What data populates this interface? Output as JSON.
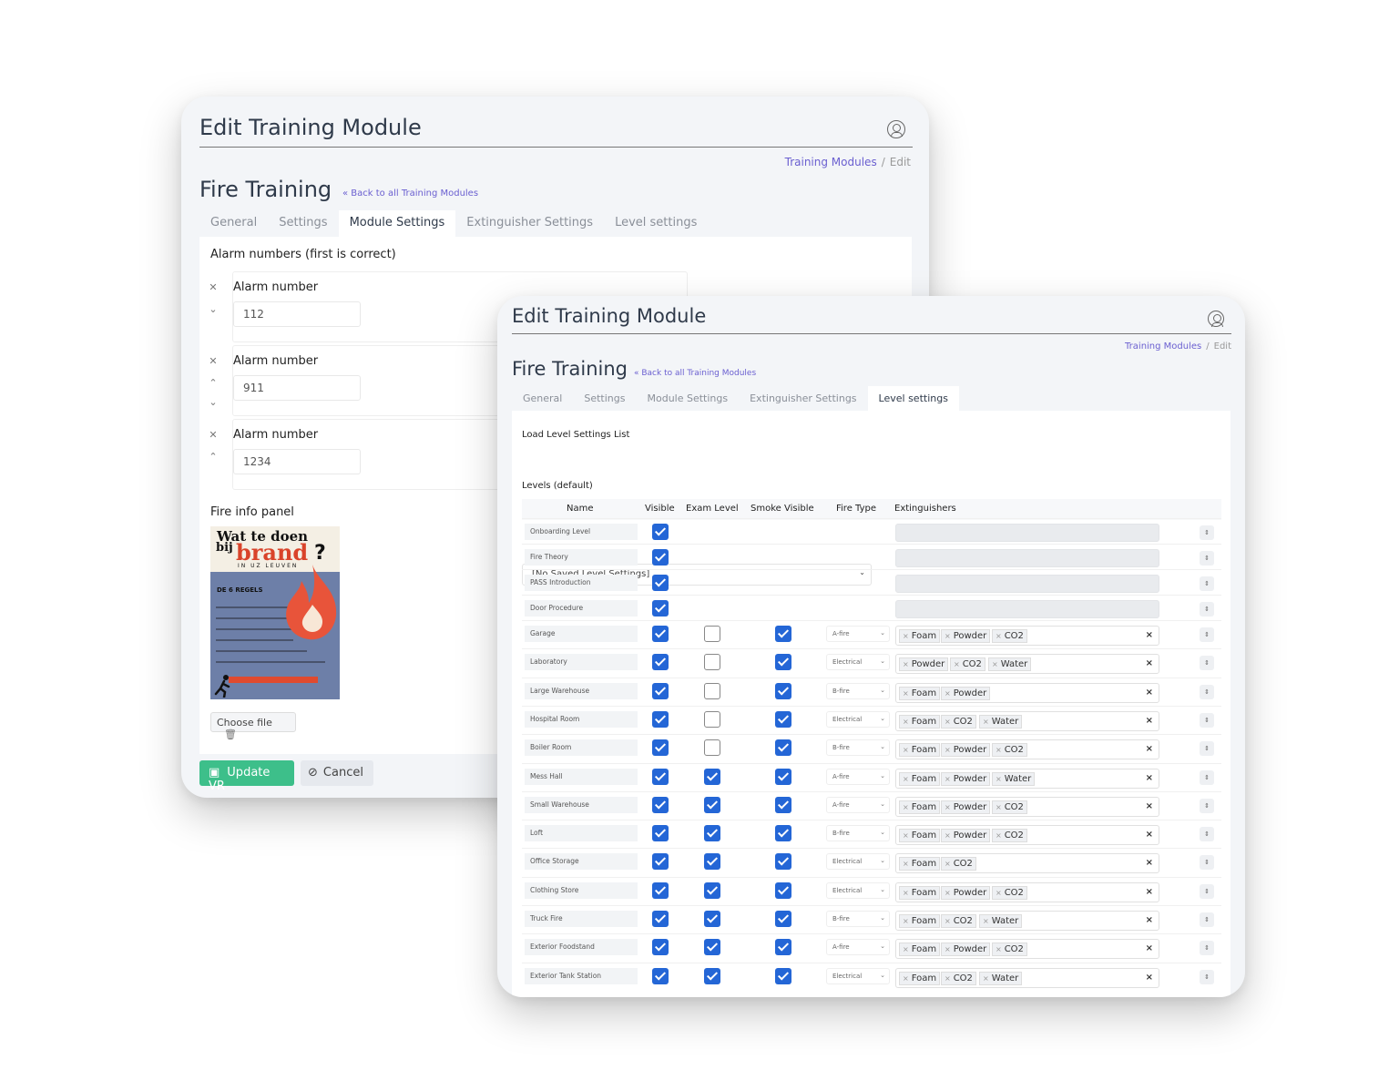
{
  "back_window": {
    "header_title": "Edit Training Module",
    "breadcrumb": {
      "link": "Training Modules",
      "separator": "/",
      "current": "Edit"
    },
    "page_title": "Fire Training",
    "back_link": "« Back to all Training Modules",
    "tabs": [
      "General",
      "Settings",
      "Module Settings",
      "Extinguisher Settings",
      "Level settings"
    ],
    "active_tab": "Module Settings",
    "alarm_section_label": "Alarm numbers (first is correct)",
    "alarm_entries": [
      {
        "label": "Alarm number",
        "value": "112"
      },
      {
        "label": "Alarm number",
        "value": "911"
      },
      {
        "label": "Alarm number",
        "value": "1234"
      }
    ],
    "fire_info_label": "Fire info panel",
    "poster": {
      "line1": "Wat te doen",
      "line2": "bij",
      "line3": "brand",
      "line4": "IN UZ LEUVEN",
      "rules_title": "DE 6 REGELS",
      "question_mark": "?"
    },
    "choose_file_label": "Choose file",
    "update_button_label": "Update VR",
    "cancel_button_label": "Cancel",
    "accent_color": "#3dbf8a"
  },
  "front_window": {
    "header_title": "Edit Training Module",
    "breadcrumb": {
      "link": "Training Modules",
      "separator": "/",
      "current": "Edit"
    },
    "page_title": "Fire Training",
    "back_link": "« Back to all Training Modules",
    "tabs": [
      "General",
      "Settings",
      "Module Settings",
      "Extinguisher Settings",
      "Level settings"
    ],
    "active_tab": "Level settings",
    "load_label": "Load Level Settings List",
    "load_select_value": "[No Saved Level Settings]",
    "levels_label": "Levels (default)",
    "columns": [
      "Name",
      "Visible",
      "Exam Level",
      "Smoke Visible",
      "Fire Type",
      "Extinguishers"
    ],
    "levels": [
      {
        "name": "Onboarding Level",
        "visible": true,
        "exam": null,
        "smoke": null,
        "fire_type": "",
        "extinguishers": []
      },
      {
        "name": "Fire Theory",
        "visible": true,
        "exam": null,
        "smoke": null,
        "fire_type": "",
        "extinguishers": []
      },
      {
        "name": "PASS Introduction",
        "visible": true,
        "exam": null,
        "smoke": null,
        "fire_type": "",
        "extinguishers": []
      },
      {
        "name": "Door Procedure",
        "visible": true,
        "exam": null,
        "smoke": null,
        "fire_type": "",
        "extinguishers": []
      },
      {
        "name": "Garage",
        "visible": true,
        "exam": false,
        "smoke": true,
        "fire_type": "A-fire",
        "extinguishers": [
          "Foam",
          "Powder",
          "CO2"
        ]
      },
      {
        "name": "Laboratory",
        "visible": true,
        "exam": false,
        "smoke": true,
        "fire_type": "Electrical",
        "extinguishers": [
          "Powder",
          "CO2",
          "Water"
        ]
      },
      {
        "name": "Large Warehouse",
        "visible": true,
        "exam": false,
        "smoke": true,
        "fire_type": "B-fire",
        "extinguishers": [
          "Foam",
          "Powder"
        ]
      },
      {
        "name": "Hospital Room",
        "visible": true,
        "exam": false,
        "smoke": true,
        "fire_type": "Electrical",
        "extinguishers": [
          "Foam",
          "CO2",
          "Water"
        ]
      },
      {
        "name": "Boiler Room",
        "visible": true,
        "exam": false,
        "smoke": true,
        "fire_type": "B-fire",
        "extinguishers": [
          "Foam",
          "Powder",
          "CO2"
        ]
      },
      {
        "name": "Mess Hall",
        "visible": true,
        "exam": true,
        "smoke": true,
        "fire_type": "A-fire",
        "extinguishers": [
          "Foam",
          "Powder",
          "Water"
        ]
      },
      {
        "name": "Small Warehouse",
        "visible": true,
        "exam": true,
        "smoke": true,
        "fire_type": "A-fire",
        "extinguishers": [
          "Foam",
          "Powder",
          "CO2"
        ]
      },
      {
        "name": "Loft",
        "visible": true,
        "exam": true,
        "smoke": true,
        "fire_type": "B-fire",
        "extinguishers": [
          "Foam",
          "Powder",
          "CO2"
        ]
      },
      {
        "name": "Office Storage",
        "visible": true,
        "exam": true,
        "smoke": true,
        "fire_type": "Electrical",
        "extinguishers": [
          "Foam",
          "CO2"
        ]
      },
      {
        "name": "Clothing Store",
        "visible": true,
        "exam": true,
        "smoke": true,
        "fire_type": "Electrical",
        "extinguishers": [
          "Foam",
          "Powder",
          "CO2"
        ]
      },
      {
        "name": "Truck Fire",
        "visible": true,
        "exam": true,
        "smoke": true,
        "fire_type": "B-fire",
        "extinguishers": [
          "Foam",
          "CO2",
          "Water"
        ]
      },
      {
        "name": "Exterior Foodstand",
        "visible": true,
        "exam": true,
        "smoke": true,
        "fire_type": "A-fire",
        "extinguishers": [
          "Foam",
          "Powder",
          "CO2"
        ]
      },
      {
        "name": "Exterior Tank Station",
        "visible": true,
        "exam": true,
        "smoke": true,
        "fire_type": "Electrical",
        "extinguishers": [
          "Foam",
          "CO2",
          "Water"
        ]
      }
    ],
    "checkbox_color": "#2466d6",
    "tag_remove_glyph": "×",
    "clear_glyph": "×",
    "dropdown_glyph": "⌄",
    "handle_glyph": "⇕"
  }
}
